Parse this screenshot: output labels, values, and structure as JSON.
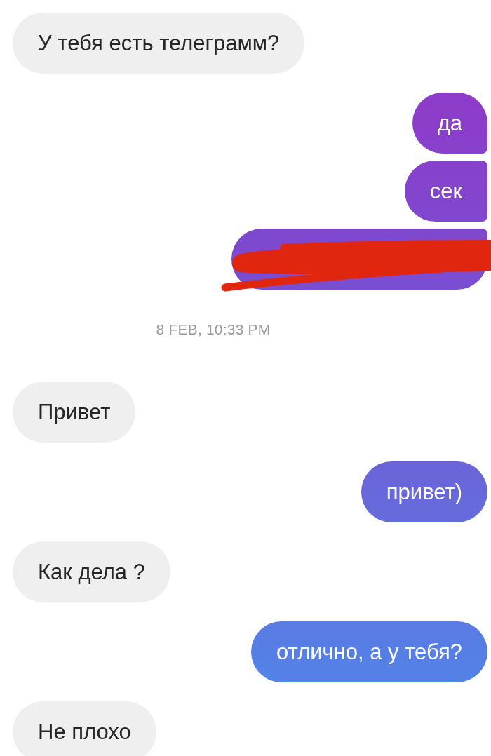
{
  "items": [
    {
      "kind": "incoming_message",
      "text": "У тебя есть телеграмм?"
    },
    {
      "kind": "outgoing_message",
      "text": "да"
    },
    {
      "kind": "outgoing_message",
      "text": "сек"
    },
    {
      "kind": "outgoing_redacted_message"
    },
    {
      "kind": "timestamp",
      "text": "8 FEB, 10:33 PM"
    },
    {
      "kind": "incoming_message",
      "text": "Привет"
    },
    {
      "kind": "outgoing_message",
      "text": "привет)"
    },
    {
      "kind": "incoming_message",
      "text": "Как дела ?"
    },
    {
      "kind": "outgoing_message",
      "text": "отлично, а у тебя?"
    },
    {
      "kind": "incoming_message",
      "text": "Не плохо"
    }
  ]
}
